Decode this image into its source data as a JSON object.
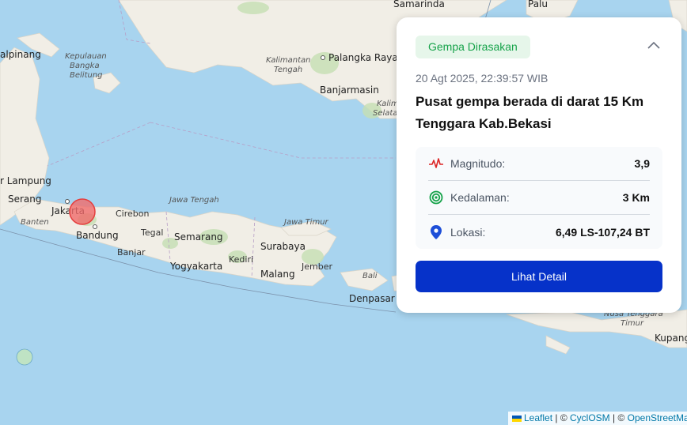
{
  "map": {
    "labels": {
      "samarinda": "Samarinda",
      "palu": "Palu",
      "kepulauan_bangka_belitung": [
        "Kepulauan",
        "Bangka",
        "Belitung"
      ],
      "alpinang": "alpinang",
      "kalimantan_tengah": [
        "Kalimantan",
        "Tengah"
      ],
      "palangka_raya": "Palangka Raya",
      "banjarmasin": "Banjarmasin",
      "kalimantan_selatan": [
        "Kaliman",
        "Selatan"
      ],
      "lampung": "r Lampung",
      "serang": "Serang",
      "banten": "Banten",
      "jakarta": "Jakarta",
      "bandung": "Bandung",
      "banjar": "Banjar",
      "cirebon": "Cirebon",
      "tegal": "Tegal",
      "jawa_tengah": "Jawa Tengah",
      "semarang": "Semarang",
      "yogyakarta": "Yogyakarta",
      "kediri": "Kediri",
      "jawa_timur": "Jawa Timur",
      "surabaya": "Surabaya",
      "malang": "Malang",
      "jember": "Jember",
      "bali": "Bali",
      "denpasar": "Denpasar",
      "nusa_tenggara_timur": [
        "Nusa Tenggara",
        "Timur"
      ],
      "kupang": "Kupang"
    },
    "epicenter_marker": "epicenter"
  },
  "card": {
    "badge": "Gempa Dirasakan",
    "datetime": "20 Agt 2025, 22:39:57 WIB",
    "headline": "Pusat gempa berada di darat 15 Km Tenggara Kab.Bekasi",
    "rows": [
      {
        "label": "Magnitudo:",
        "value": "3,9",
        "icon": "pulse-icon",
        "color": "#dc2626"
      },
      {
        "label": "Kedalaman:",
        "value": "3 Km",
        "icon": "target-icon",
        "color": "#16a34a"
      },
      {
        "label": "Lokasi:",
        "value": "6,49 LS-107,24 BT",
        "icon": "map-pin-icon",
        "color": "#1d4ed8"
      }
    ],
    "button": "Lihat Detail"
  },
  "attribution": {
    "leaflet": "Leaflet",
    "sep1": " | © ",
    "cyclosm": "CyclOSM",
    "sep2": " | © ",
    "osm": "OpenStreetMap"
  },
  "colors": {
    "sea": "#a8d4ef",
    "land": "#f1eee6",
    "accent": "#0632c9",
    "badge_text": "#16a34a",
    "badge_bg": "#e6f6ea"
  }
}
